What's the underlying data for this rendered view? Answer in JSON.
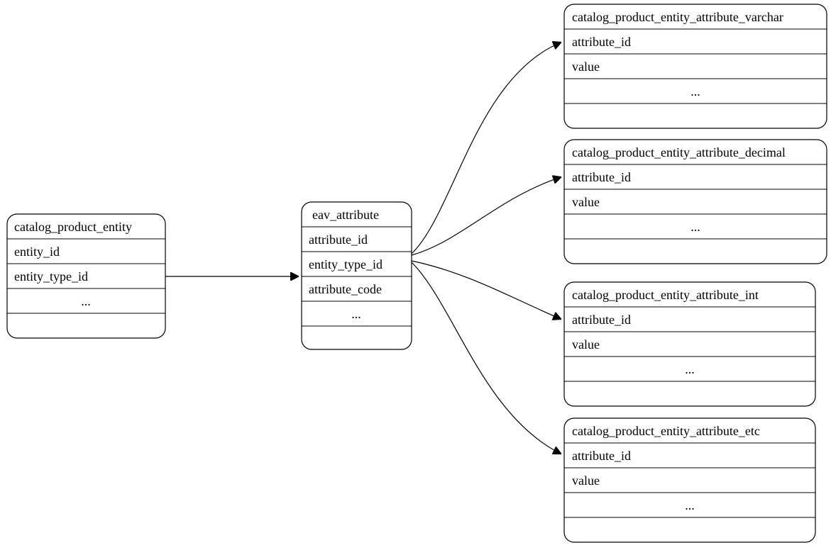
{
  "diagram": {
    "type": "er-diagram",
    "description": "Magento EAV attribute model: catalog_product_entity links to eav_attribute, which fans out to typed value tables.",
    "nodes": {
      "cpe": {
        "title": "catalog_product_entity",
        "rows": [
          "entity_id",
          "entity_type_id",
          "...",
          ""
        ]
      },
      "eav": {
        "title": "eav_attribute",
        "rows": [
          "attribute_id",
          "entity_type_id",
          "attribute_code",
          "...",
          ""
        ]
      },
      "varchar": {
        "title": "catalog_product_entity_attribute_varchar",
        "rows": [
          "attribute_id",
          "value",
          "...",
          ""
        ]
      },
      "decimal": {
        "title": "catalog_product_entity_attribute_decimal",
        "rows": [
          "attribute_id",
          "value",
          "...",
          ""
        ]
      },
      "int": {
        "title": "catalog_product_entity_attribute_int",
        "rows": [
          "attribute_id",
          "value",
          "...",
          ""
        ]
      },
      "etc": {
        "title": "catalog_product_entity_attribute_etc",
        "rows": [
          "attribute_id",
          "value",
          "...",
          ""
        ]
      }
    },
    "edges": [
      {
        "from": "cpe",
        "to": "eav"
      },
      {
        "from": "eav",
        "to": "varchar"
      },
      {
        "from": "eav",
        "to": "decimal"
      },
      {
        "from": "eav",
        "to": "int"
      },
      {
        "from": "eav",
        "to": "etc"
      }
    ]
  }
}
